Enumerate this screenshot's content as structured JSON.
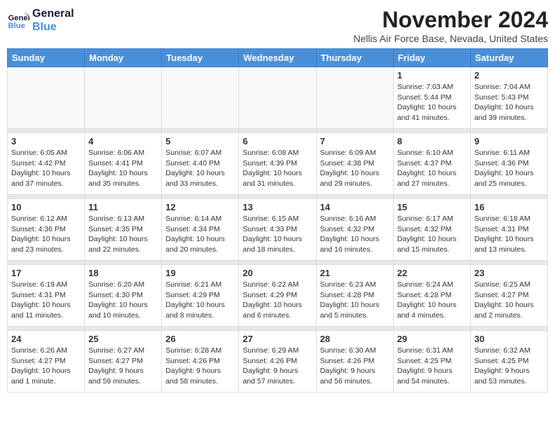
{
  "logo": {
    "line1": "General",
    "line2": "Blue"
  },
  "title": "November 2024",
  "subtitle": "Nellis Air Force Base, Nevada, United States",
  "headers": [
    "Sunday",
    "Monday",
    "Tuesday",
    "Wednesday",
    "Thursday",
    "Friday",
    "Saturday"
  ],
  "weeks": [
    [
      {
        "day": "",
        "info": ""
      },
      {
        "day": "",
        "info": ""
      },
      {
        "day": "",
        "info": ""
      },
      {
        "day": "",
        "info": ""
      },
      {
        "day": "",
        "info": ""
      },
      {
        "day": "1",
        "info": "Sunrise: 7:03 AM\nSunset: 5:44 PM\nDaylight: 10 hours and 41 minutes."
      },
      {
        "day": "2",
        "info": "Sunrise: 7:04 AM\nSunset: 5:43 PM\nDaylight: 10 hours and 39 minutes."
      }
    ],
    [
      {
        "day": "3",
        "info": "Sunrise: 6:05 AM\nSunset: 4:42 PM\nDaylight: 10 hours and 37 minutes."
      },
      {
        "day": "4",
        "info": "Sunrise: 6:06 AM\nSunset: 4:41 PM\nDaylight: 10 hours and 35 minutes."
      },
      {
        "day": "5",
        "info": "Sunrise: 6:07 AM\nSunset: 4:40 PM\nDaylight: 10 hours and 33 minutes."
      },
      {
        "day": "6",
        "info": "Sunrise: 6:08 AM\nSunset: 4:39 PM\nDaylight: 10 hours and 31 minutes."
      },
      {
        "day": "7",
        "info": "Sunrise: 6:09 AM\nSunset: 4:38 PM\nDaylight: 10 hours and 29 minutes."
      },
      {
        "day": "8",
        "info": "Sunrise: 6:10 AM\nSunset: 4:37 PM\nDaylight: 10 hours and 27 minutes."
      },
      {
        "day": "9",
        "info": "Sunrise: 6:11 AM\nSunset: 4:36 PM\nDaylight: 10 hours and 25 minutes."
      }
    ],
    [
      {
        "day": "10",
        "info": "Sunrise: 6:12 AM\nSunset: 4:36 PM\nDaylight: 10 hours and 23 minutes."
      },
      {
        "day": "11",
        "info": "Sunrise: 6:13 AM\nSunset: 4:35 PM\nDaylight: 10 hours and 22 minutes."
      },
      {
        "day": "12",
        "info": "Sunrise: 6:14 AM\nSunset: 4:34 PM\nDaylight: 10 hours and 20 minutes."
      },
      {
        "day": "13",
        "info": "Sunrise: 6:15 AM\nSunset: 4:33 PM\nDaylight: 10 hours and 18 minutes."
      },
      {
        "day": "14",
        "info": "Sunrise: 6:16 AM\nSunset: 4:32 PM\nDaylight: 10 hours and 16 minutes."
      },
      {
        "day": "15",
        "info": "Sunrise: 6:17 AM\nSunset: 4:32 PM\nDaylight: 10 hours and 15 minutes."
      },
      {
        "day": "16",
        "info": "Sunrise: 6:18 AM\nSunset: 4:31 PM\nDaylight: 10 hours and 13 minutes."
      }
    ],
    [
      {
        "day": "17",
        "info": "Sunrise: 6:19 AM\nSunset: 4:31 PM\nDaylight: 10 hours and 11 minutes."
      },
      {
        "day": "18",
        "info": "Sunrise: 6:20 AM\nSunset: 4:30 PM\nDaylight: 10 hours and 10 minutes."
      },
      {
        "day": "19",
        "info": "Sunrise: 6:21 AM\nSunset: 4:29 PM\nDaylight: 10 hours and 8 minutes."
      },
      {
        "day": "20",
        "info": "Sunrise: 6:22 AM\nSunset: 4:29 PM\nDaylight: 10 hours and 6 minutes."
      },
      {
        "day": "21",
        "info": "Sunrise: 6:23 AM\nSunset: 4:28 PM\nDaylight: 10 hours and 5 minutes."
      },
      {
        "day": "22",
        "info": "Sunrise: 6:24 AM\nSunset: 4:28 PM\nDaylight: 10 hours and 4 minutes."
      },
      {
        "day": "23",
        "info": "Sunrise: 6:25 AM\nSunset: 4:27 PM\nDaylight: 10 hours and 2 minutes."
      }
    ],
    [
      {
        "day": "24",
        "info": "Sunrise: 6:26 AM\nSunset: 4:27 PM\nDaylight: 10 hours and 1 minute."
      },
      {
        "day": "25",
        "info": "Sunrise: 6:27 AM\nSunset: 4:27 PM\nDaylight: 9 hours and 59 minutes."
      },
      {
        "day": "26",
        "info": "Sunrise: 6:28 AM\nSunset: 4:26 PM\nDaylight: 9 hours and 58 minutes."
      },
      {
        "day": "27",
        "info": "Sunrise: 6:29 AM\nSunset: 4:26 PM\nDaylight: 9 hours and 57 minutes."
      },
      {
        "day": "28",
        "info": "Sunrise: 6:30 AM\nSunset: 4:26 PM\nDaylight: 9 hours and 56 minutes."
      },
      {
        "day": "29",
        "info": "Sunrise: 6:31 AM\nSunset: 4:25 PM\nDaylight: 9 hours and 54 minutes."
      },
      {
        "day": "30",
        "info": "Sunrise: 6:32 AM\nSunset: 4:25 PM\nDaylight: 9 hours and 53 minutes."
      }
    ]
  ]
}
